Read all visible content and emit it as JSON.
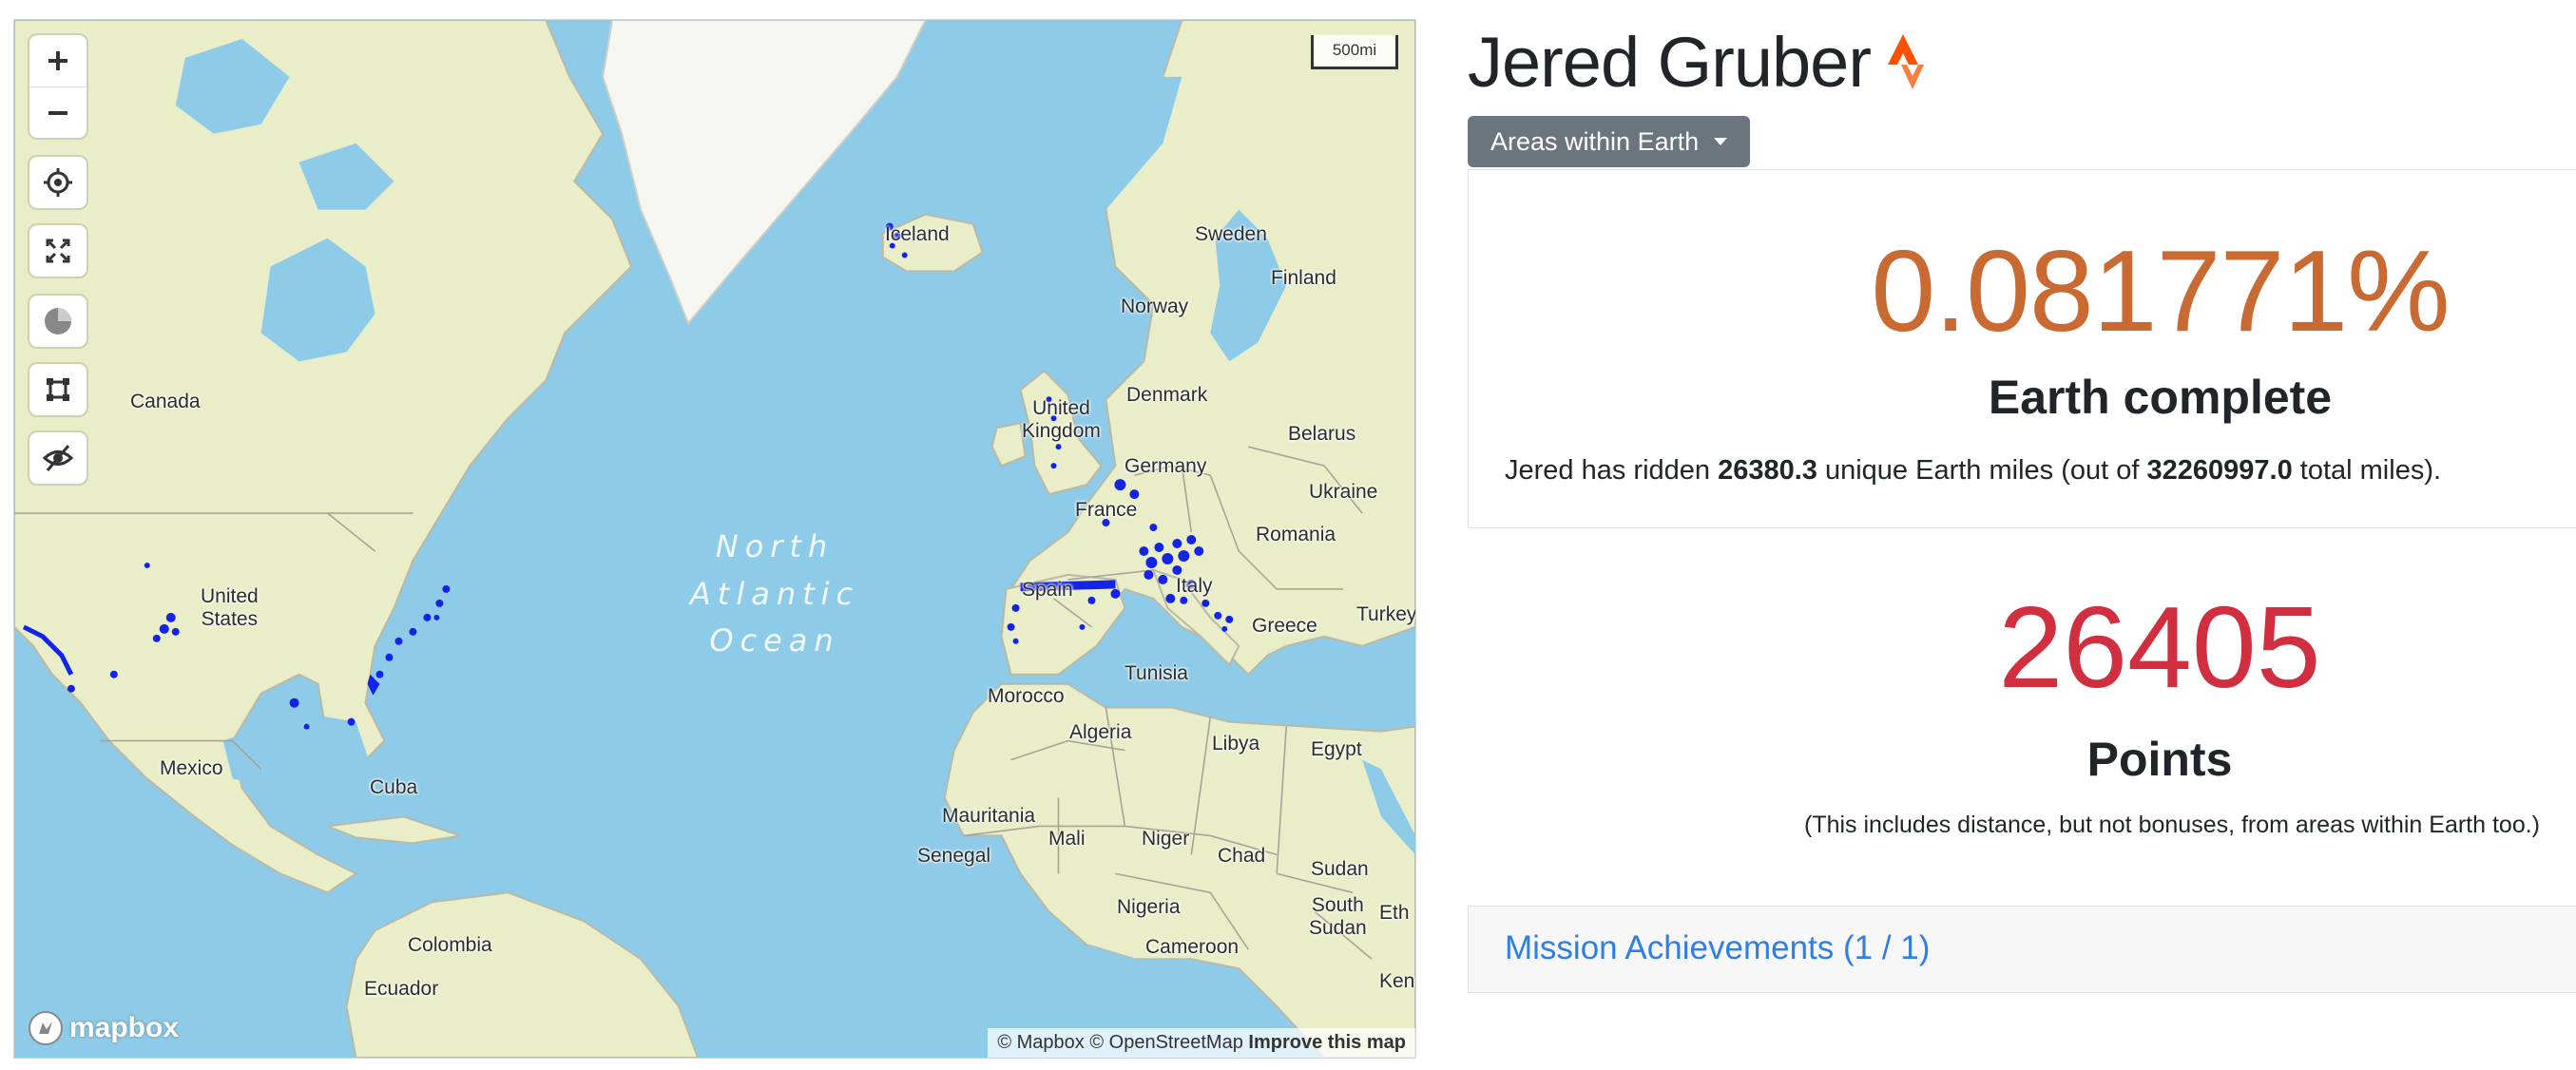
{
  "map": {
    "scale_label": "500mi",
    "ocean_label": [
      "North",
      "Atlantic",
      "Ocean"
    ],
    "logo_text": "mapbox",
    "attribution": {
      "mapbox": "© Mapbox",
      "osm": "© OpenStreetMap",
      "improve": "Improve this map"
    },
    "controls": [
      "zoom-in-icon",
      "zoom-out-icon",
      "locate-icon",
      "fullscreen-icon",
      "history-icon",
      "draw-area-icon",
      "hide-icon"
    ],
    "places": {
      "canada": "Canada",
      "united_states": "United\nStates",
      "mexico": "Mexico",
      "cuba": "Cuba",
      "colombia": "Colombia",
      "ecuador": "Ecuador",
      "iceland": "Iceland",
      "sweden": "Sweden",
      "finland": "Finland",
      "norway": "Norway",
      "denmark": "Denmark",
      "united_kingdom": "United\nKingdom",
      "germany": "Germany",
      "belarus": "Belarus",
      "ukraine": "Ukraine",
      "france": "France",
      "romania": "Romania",
      "italy": "Italy",
      "spain": "Spain",
      "greece": "Greece",
      "turkey": "Turkey",
      "tunisia": "Tunisia",
      "morocco": "Morocco",
      "algeria": "Algeria",
      "libya": "Libya",
      "egypt": "Egypt",
      "mauritania": "Mauritania",
      "mali": "Mali",
      "niger": "Niger",
      "chad": "Chad",
      "senegal": "Senegal",
      "sudan": "Sudan",
      "nigeria": "Nigeria",
      "south_sudan": "South\nSudan",
      "ethiopia_partial": "Eth",
      "cameroon": "Cameroon",
      "kenya_partial": "Ken"
    }
  },
  "profile": {
    "name": "Jered Gruber",
    "strava_icon": "strava-logo-icon",
    "area_dropdown": "Areas within Earth",
    "percent_complete": "0.081771%",
    "percent_label": "Earth complete",
    "summary": {
      "prefix": "Jered has ridden ",
      "unique_miles": "26380.3",
      "middle": " unique Earth miles (out of ",
      "total_miles": "32260997.0",
      "suffix": " total miles)."
    },
    "points": "26405",
    "points_label": "Points",
    "points_note": "(This includes distance, but not bonuses, from areas within Earth too.)",
    "mission_achievements": "Mission Achievements (1 / 1)"
  },
  "colors": {
    "percent": "#c86a32",
    "points": "#d12f3f",
    "link": "#2f7ee8",
    "ride_tracks": "#1424e6",
    "water": "#8ecbe9",
    "land": "#e9eec8",
    "strava": "#fc5200"
  }
}
